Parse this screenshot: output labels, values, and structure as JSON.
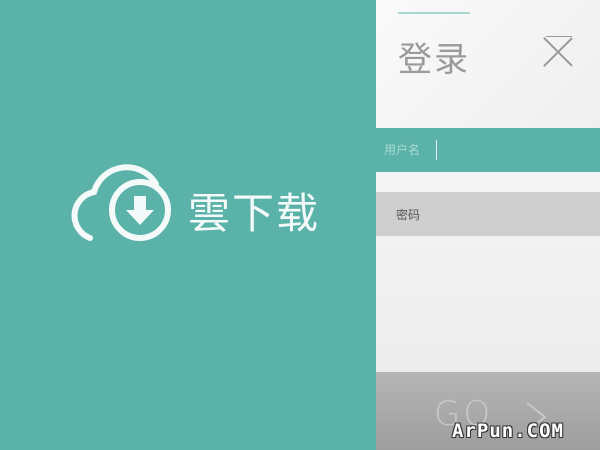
{
  "brand": {
    "name": "雲下载",
    "logo_icon": "cloud-download-icon",
    "color": "#5ab2a8"
  },
  "login": {
    "title": "登录",
    "close_icon": "close-icon",
    "username_label": "用户名",
    "username_value": "",
    "password_label": "密码",
    "password_value": "",
    "submit_label": "GO",
    "submit_icon": "chevron-right-icon"
  },
  "watermark": "ArPun.COM"
}
